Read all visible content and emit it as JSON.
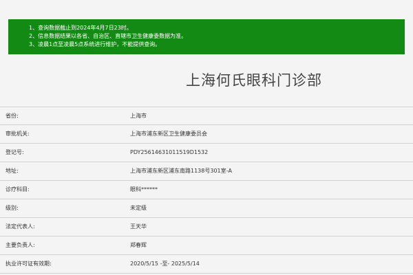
{
  "notice": {
    "lines": [
      "1、查询数据截止到2024年4月7日23时。",
      "2、信息数据结果以各省、自治区、直辖市卫生健康委数据为准。",
      "3、凌晨1点至凌晨5点系统进行维护，不能提供查询。"
    ]
  },
  "title": "上海何氏眼科门诊部",
  "rows": [
    {
      "label": "省份:",
      "value": "上海市"
    },
    {
      "label": "审批机关:",
      "value": "上海市浦东新区卫生健康委员会"
    },
    {
      "label": "登记号:",
      "value": "PDY25614631011519D1532"
    },
    {
      "label": "地址:",
      "value": "上海市浦东新区浦东南路1138号301室-A"
    },
    {
      "label": "诊疗科目:",
      "value": "眼科******"
    },
    {
      "label": "级别:",
      "value": "未定级"
    },
    {
      "label": "法定代表人:",
      "value": "王天华"
    },
    {
      "label": "主要负责人:",
      "value": "郑春辉"
    },
    {
      "label": "执业许可证有效期:",
      "value": "2020/5/15 -至- 2025/5/14"
    }
  ]
}
